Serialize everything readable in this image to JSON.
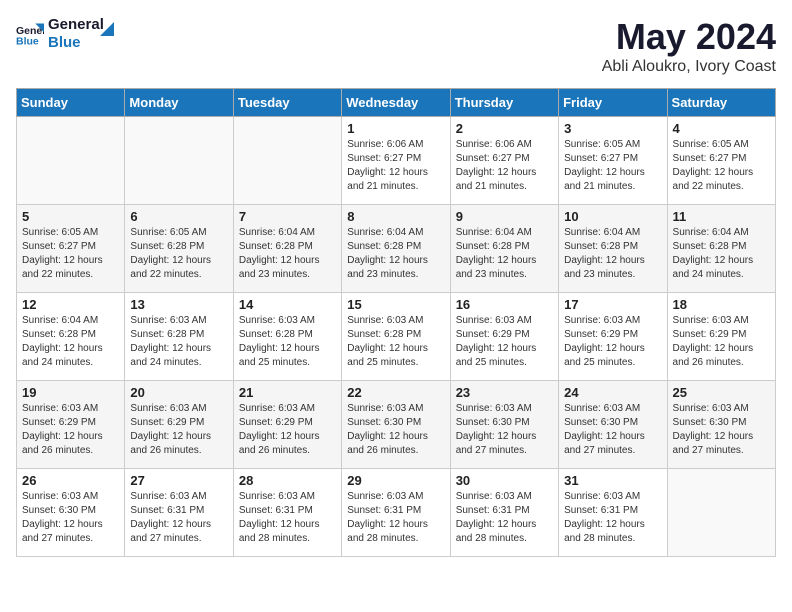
{
  "header": {
    "logo_line1": "General",
    "logo_line2": "Blue",
    "month_title": "May 2024",
    "location": "Abli Aloukro, Ivory Coast"
  },
  "weekdays": [
    "Sunday",
    "Monday",
    "Tuesday",
    "Wednesday",
    "Thursday",
    "Friday",
    "Saturday"
  ],
  "weeks": [
    [
      {
        "day": "",
        "sunrise": "",
        "sunset": "",
        "daylight": ""
      },
      {
        "day": "",
        "sunrise": "",
        "sunset": "",
        "daylight": ""
      },
      {
        "day": "",
        "sunrise": "",
        "sunset": "",
        "daylight": ""
      },
      {
        "day": "1",
        "sunrise": "Sunrise: 6:06 AM",
        "sunset": "Sunset: 6:27 PM",
        "daylight": "Daylight: 12 hours and 21 minutes."
      },
      {
        "day": "2",
        "sunrise": "Sunrise: 6:06 AM",
        "sunset": "Sunset: 6:27 PM",
        "daylight": "Daylight: 12 hours and 21 minutes."
      },
      {
        "day": "3",
        "sunrise": "Sunrise: 6:05 AM",
        "sunset": "Sunset: 6:27 PM",
        "daylight": "Daylight: 12 hours and 21 minutes."
      },
      {
        "day": "4",
        "sunrise": "Sunrise: 6:05 AM",
        "sunset": "Sunset: 6:27 PM",
        "daylight": "Daylight: 12 hours and 22 minutes."
      }
    ],
    [
      {
        "day": "5",
        "sunrise": "Sunrise: 6:05 AM",
        "sunset": "Sunset: 6:27 PM",
        "daylight": "Daylight: 12 hours and 22 minutes."
      },
      {
        "day": "6",
        "sunrise": "Sunrise: 6:05 AM",
        "sunset": "Sunset: 6:28 PM",
        "daylight": "Daylight: 12 hours and 22 minutes."
      },
      {
        "day": "7",
        "sunrise": "Sunrise: 6:04 AM",
        "sunset": "Sunset: 6:28 PM",
        "daylight": "Daylight: 12 hours and 23 minutes."
      },
      {
        "day": "8",
        "sunrise": "Sunrise: 6:04 AM",
        "sunset": "Sunset: 6:28 PM",
        "daylight": "Daylight: 12 hours and 23 minutes."
      },
      {
        "day": "9",
        "sunrise": "Sunrise: 6:04 AM",
        "sunset": "Sunset: 6:28 PM",
        "daylight": "Daylight: 12 hours and 23 minutes."
      },
      {
        "day": "10",
        "sunrise": "Sunrise: 6:04 AM",
        "sunset": "Sunset: 6:28 PM",
        "daylight": "Daylight: 12 hours and 23 minutes."
      },
      {
        "day": "11",
        "sunrise": "Sunrise: 6:04 AM",
        "sunset": "Sunset: 6:28 PM",
        "daylight": "Daylight: 12 hours and 24 minutes."
      }
    ],
    [
      {
        "day": "12",
        "sunrise": "Sunrise: 6:04 AM",
        "sunset": "Sunset: 6:28 PM",
        "daylight": "Daylight: 12 hours and 24 minutes."
      },
      {
        "day": "13",
        "sunrise": "Sunrise: 6:03 AM",
        "sunset": "Sunset: 6:28 PM",
        "daylight": "Daylight: 12 hours and 24 minutes."
      },
      {
        "day": "14",
        "sunrise": "Sunrise: 6:03 AM",
        "sunset": "Sunset: 6:28 PM",
        "daylight": "Daylight: 12 hours and 25 minutes."
      },
      {
        "day": "15",
        "sunrise": "Sunrise: 6:03 AM",
        "sunset": "Sunset: 6:28 PM",
        "daylight": "Daylight: 12 hours and 25 minutes."
      },
      {
        "day": "16",
        "sunrise": "Sunrise: 6:03 AM",
        "sunset": "Sunset: 6:29 PM",
        "daylight": "Daylight: 12 hours and 25 minutes."
      },
      {
        "day": "17",
        "sunrise": "Sunrise: 6:03 AM",
        "sunset": "Sunset: 6:29 PM",
        "daylight": "Daylight: 12 hours and 25 minutes."
      },
      {
        "day": "18",
        "sunrise": "Sunrise: 6:03 AM",
        "sunset": "Sunset: 6:29 PM",
        "daylight": "Daylight: 12 hours and 26 minutes."
      }
    ],
    [
      {
        "day": "19",
        "sunrise": "Sunrise: 6:03 AM",
        "sunset": "Sunset: 6:29 PM",
        "daylight": "Daylight: 12 hours and 26 minutes."
      },
      {
        "day": "20",
        "sunrise": "Sunrise: 6:03 AM",
        "sunset": "Sunset: 6:29 PM",
        "daylight": "Daylight: 12 hours and 26 minutes."
      },
      {
        "day": "21",
        "sunrise": "Sunrise: 6:03 AM",
        "sunset": "Sunset: 6:29 PM",
        "daylight": "Daylight: 12 hours and 26 minutes."
      },
      {
        "day": "22",
        "sunrise": "Sunrise: 6:03 AM",
        "sunset": "Sunset: 6:30 PM",
        "daylight": "Daylight: 12 hours and 26 minutes."
      },
      {
        "day": "23",
        "sunrise": "Sunrise: 6:03 AM",
        "sunset": "Sunset: 6:30 PM",
        "daylight": "Daylight: 12 hours and 27 minutes."
      },
      {
        "day": "24",
        "sunrise": "Sunrise: 6:03 AM",
        "sunset": "Sunset: 6:30 PM",
        "daylight": "Daylight: 12 hours and 27 minutes."
      },
      {
        "day": "25",
        "sunrise": "Sunrise: 6:03 AM",
        "sunset": "Sunset: 6:30 PM",
        "daylight": "Daylight: 12 hours and 27 minutes."
      }
    ],
    [
      {
        "day": "26",
        "sunrise": "Sunrise: 6:03 AM",
        "sunset": "Sunset: 6:30 PM",
        "daylight": "Daylight: 12 hours and 27 minutes."
      },
      {
        "day": "27",
        "sunrise": "Sunrise: 6:03 AM",
        "sunset": "Sunset: 6:31 PM",
        "daylight": "Daylight: 12 hours and 27 minutes."
      },
      {
        "day": "28",
        "sunrise": "Sunrise: 6:03 AM",
        "sunset": "Sunset: 6:31 PM",
        "daylight": "Daylight: 12 hours and 28 minutes."
      },
      {
        "day": "29",
        "sunrise": "Sunrise: 6:03 AM",
        "sunset": "Sunset: 6:31 PM",
        "daylight": "Daylight: 12 hours and 28 minutes."
      },
      {
        "day": "30",
        "sunrise": "Sunrise: 6:03 AM",
        "sunset": "Sunset: 6:31 PM",
        "daylight": "Daylight: 12 hours and 28 minutes."
      },
      {
        "day": "31",
        "sunrise": "Sunrise: 6:03 AM",
        "sunset": "Sunset: 6:31 PM",
        "daylight": "Daylight: 12 hours and 28 minutes."
      },
      {
        "day": "",
        "sunrise": "",
        "sunset": "",
        "daylight": ""
      }
    ]
  ]
}
